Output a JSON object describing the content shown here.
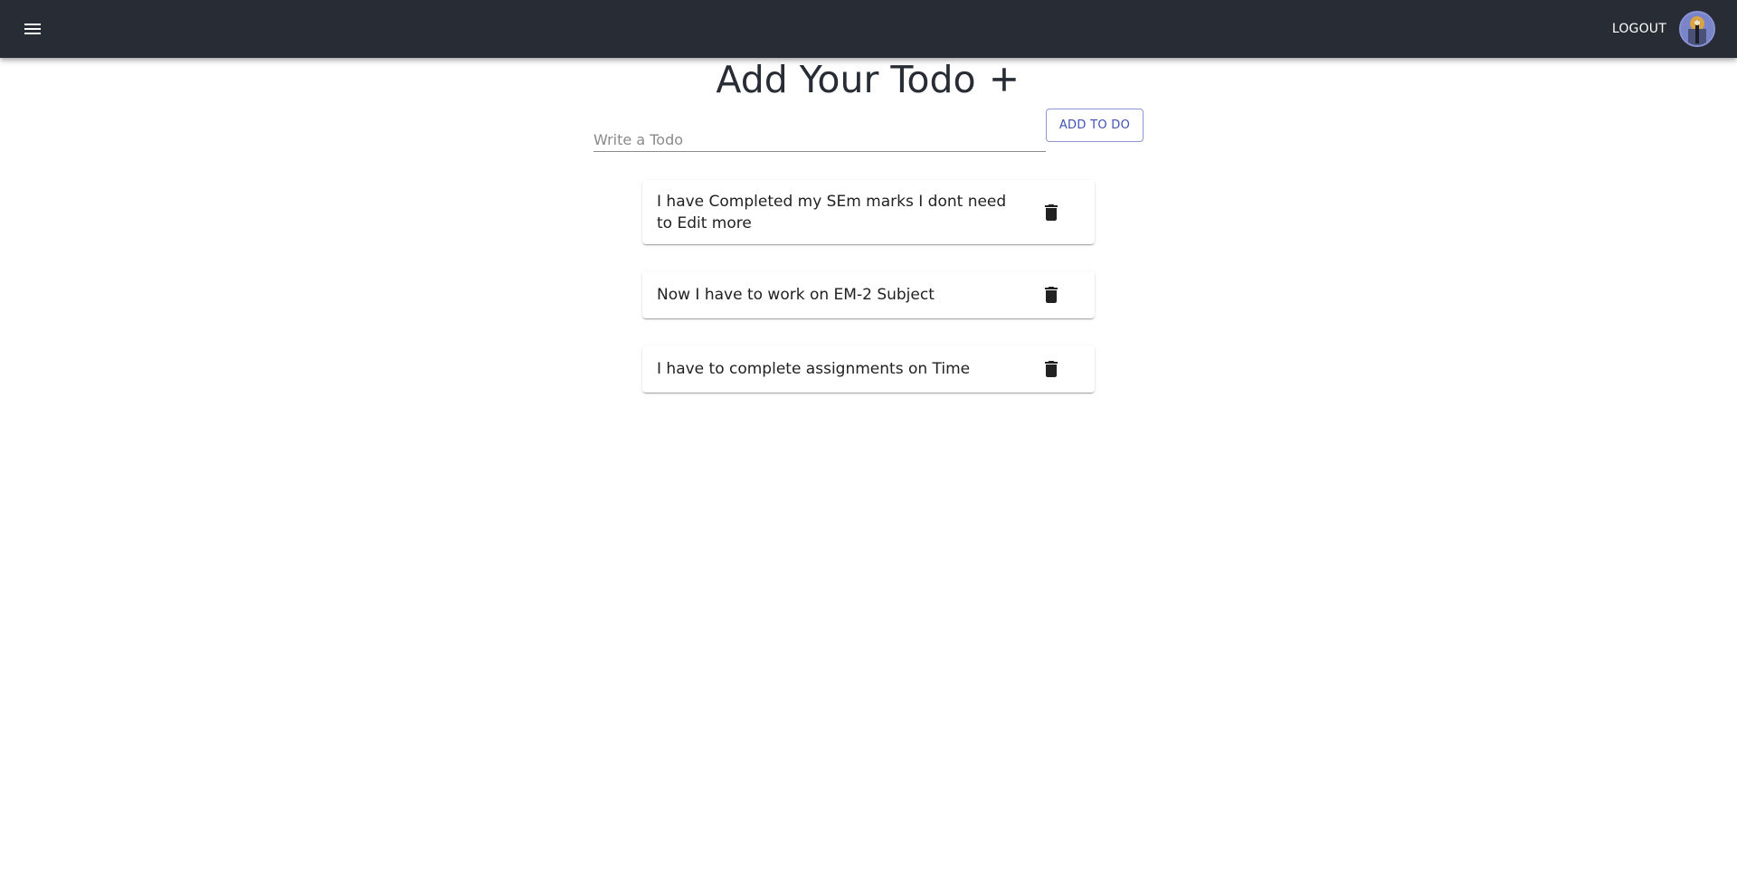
{
  "header": {
    "logout_label": "LOGOUT",
    "menu_icon": "menu-icon",
    "avatar": "user-avatar",
    "background": "#282c34"
  },
  "main": {
    "title": "Add Your Todo",
    "title_icon": "plus-icon",
    "input_placeholder": "Write a Todo",
    "input_value": "",
    "add_button_label": "ADD TO DO"
  },
  "todos": [
    {
      "text": "I have Completed my SEm marks I dont need to Edit more",
      "action_icon": "delete-icon"
    },
    {
      "text": "Now I have to work on EM-2 Subject",
      "action_icon": "delete-icon"
    },
    {
      "text": "I have to complete assignments on Time",
      "action_icon": "delete-icon"
    }
  ],
  "colors": {
    "accent": "#3f51b5",
    "text": "#212121",
    "title": "#282c34"
  }
}
